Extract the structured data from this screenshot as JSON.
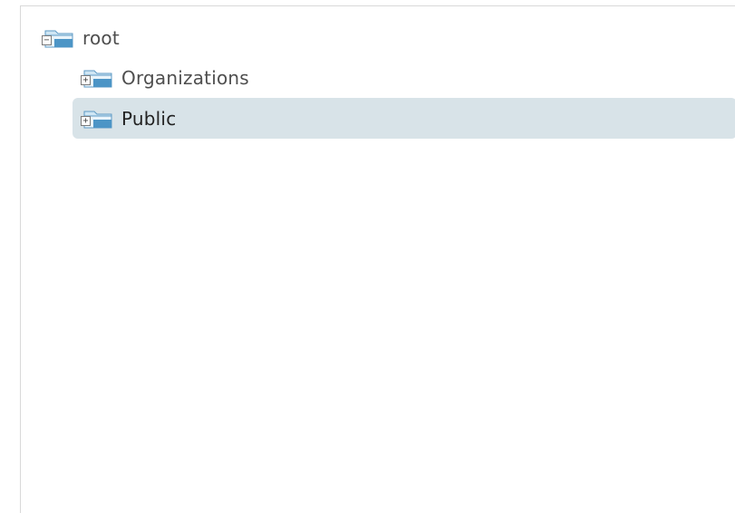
{
  "tree": {
    "nodes": [
      {
        "label": "root",
        "expanded": true,
        "toggle": "−",
        "icon": "folder-icon"
      },
      {
        "label": "Organizations",
        "expanded": false,
        "toggle": "+",
        "icon": "folder-icon"
      },
      {
        "label": "Public",
        "expanded": false,
        "toggle": "+",
        "icon": "folder-icon",
        "selected": true
      }
    ]
  },
  "colors": {
    "selection_background": "#d8e3e8",
    "folder_blue": "#4c95c6",
    "folder_light": "#cfe6f4",
    "text": "#4e4e4e"
  }
}
